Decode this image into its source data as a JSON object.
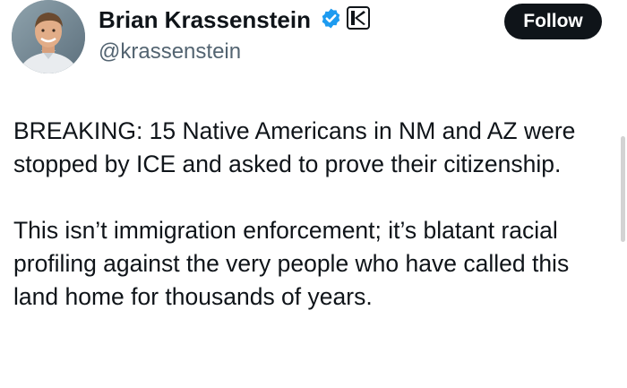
{
  "user": {
    "display_name": "Brian Krassenstein",
    "handle": "@krassenstein",
    "avatar_icon": "user-photo",
    "verified_icon": "verified-badge-icon",
    "affiliate_icon": "affiliate-k-logo-icon"
  },
  "follow_button": {
    "label": "Follow"
  },
  "tweet": {
    "paragraphs": [
      "BREAKING: 15 Native Americans in NM and AZ were stopped by ICE and asked to prove their citizenship.",
      "This isn’t immigration enforcement; it’s blatant racial profiling against the very people who have called this land home for thousands of years."
    ]
  },
  "colors": {
    "text": "#0f1419",
    "secondary": "#536471",
    "verified": "#1d9bf0",
    "button_bg": "#0f1419",
    "button_text": "#ffffff"
  }
}
